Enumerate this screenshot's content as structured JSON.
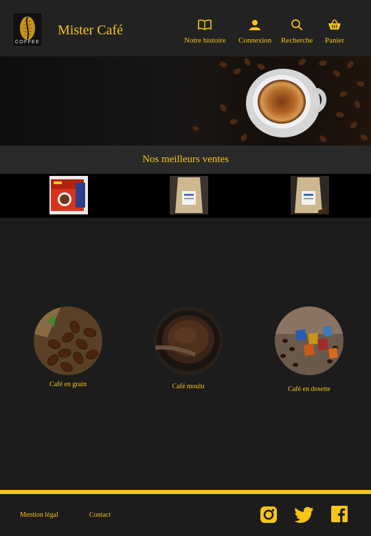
{
  "header": {
    "logo_text": "COFFEE",
    "brand": "Mister Café",
    "nav": [
      {
        "label": "Notre histoire",
        "icon": "book-icon"
      },
      {
        "label": "Connexion",
        "icon": "user-icon"
      },
      {
        "label": "Recherche",
        "icon": "search-icon"
      },
      {
        "label": "Panier",
        "icon": "basket-icon"
      }
    ]
  },
  "hero": {
    "image": "coffee-cup-with-beans"
  },
  "best_sellers": {
    "title": "Nos meilleurs ventes",
    "products": [
      {
        "image": "dolce-gusto-capsule-box"
      },
      {
        "image": "coffee-bag"
      },
      {
        "image": "coffee-bag-with-beans"
      }
    ]
  },
  "categories": [
    {
      "label": "Café en grain",
      "image": "coffee-beans-sack"
    },
    {
      "label": "Café moulu",
      "image": "ground-coffee-bowl"
    },
    {
      "label": "Café en dosette",
      "image": "coffee-capsules"
    }
  ],
  "footer": {
    "links": [
      "Mention légal",
      "Contact"
    ],
    "social": [
      "instagram-icon",
      "twitter-icon",
      "facebook-icon"
    ]
  },
  "colors": {
    "accent": "#f5c518",
    "background": "#1c1c1c",
    "header": "#222222"
  }
}
